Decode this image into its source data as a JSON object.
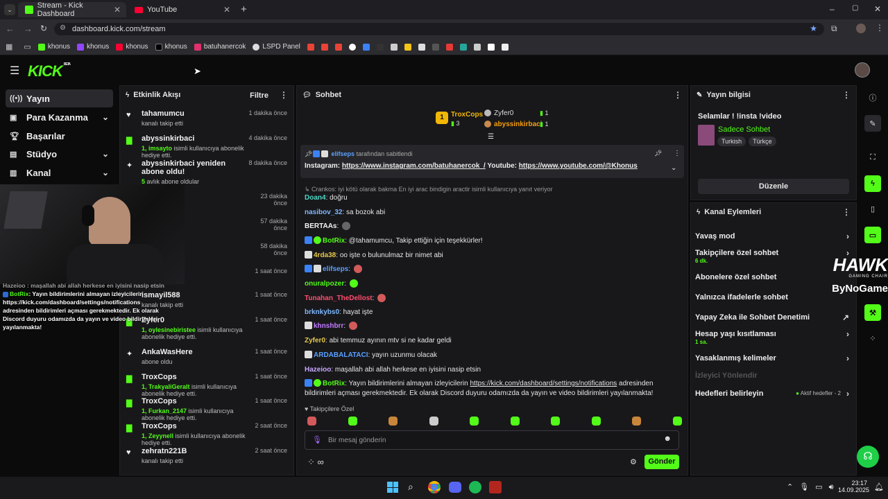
{
  "browser": {
    "tabs": [
      {
        "label": "Stream - Kick Dashboard",
        "active": true
      },
      {
        "label": "YouTube",
        "active": false
      }
    ],
    "url": "dashboard.kick.com/stream",
    "bookmarks": [
      "khonus",
      "khonus",
      "khonus",
      "khonus",
      "batuhanercok",
      "LSPD Panel"
    ]
  },
  "app": {
    "logo": "KICK",
    "logo_beta": "BETA"
  },
  "sidebar": {
    "items": [
      {
        "label": "Yayın",
        "icon": "broadcast-icon",
        "active": true,
        "chevron": false
      },
      {
        "label": "Para Kazanma",
        "icon": "money-icon",
        "active": false,
        "chevron": true
      },
      {
        "label": "Başarılar",
        "icon": "trophy-icon",
        "active": false,
        "chevron": false
      },
      {
        "label": "Stüdyo",
        "icon": "studio-icon",
        "active": false,
        "chevron": true
      },
      {
        "label": "Kanal",
        "icon": "channel-icon",
        "active": false,
        "chevron": true
      }
    ]
  },
  "overlay_chat": {
    "line1": "Hazeioo : maşallah abi allah herkese en iyisini nasip etsin",
    "line2_user": "BotRix",
    "line2_text": ": Yayın bildirimlerini almayan izleyicilerin https://kick.com/dashboard/settings/notifications adresinden bildirimleri açması gerekmektedir. Ek olarak Discord duyuru odamızda da yayın ve video bildirimleri yayılanmakta!"
  },
  "activity": {
    "title": "Etkinlik Akışı",
    "filter": "Filtre",
    "items": [
      {
        "name": "tahamumcu",
        "sub": "kanalı takip etti",
        "time": "1 dakika önce",
        "icon": "heart-icon"
      },
      {
        "name": "abyssinkirbaci",
        "sub_hl": "1, imsayto",
        "sub": " isimli kullanıcıya abonelik hediye etti.",
        "time": "4 dakika önce",
        "icon": "gift-icon"
      },
      {
        "name": "abyssinkirbaci yeniden abone oldu!",
        "sub_hl": "5",
        "sub": " avlık abone oldular",
        "time": "8 dakika önce",
        "icon": "star-icon"
      },
      {
        "name": "",
        "sub": "",
        "time": "23 dakika önce",
        "icon": ""
      },
      {
        "name": "",
        "sub": "",
        "time": "57 dakika önce",
        "icon": ""
      },
      {
        "name": "",
        "sub": "",
        "time": "58 dakika önce",
        "icon": ""
      },
      {
        "name": "",
        "sub": "",
        "time": "1 saat önce",
        "icon": ""
      },
      {
        "name": "ismayil588",
        "sub": "kanalı takip etti",
        "time": "1 saat önce",
        "icon": ""
      },
      {
        "name": "Zyfer0",
        "sub_hl": "1, oylesinebiristee",
        "sub": " isimli kullanıcıya abonelik hediye etti.",
        "time": "1 saat önce",
        "icon": "gift-icon"
      },
      {
        "name": "AnkaWasHere",
        "sub": "abone oldu",
        "time": "1 saat önce",
        "icon": "star-icon"
      },
      {
        "name": "TroxCops",
        "sub_hl": "1, TrakyaliGeralt",
        "sub": " isimli kullanıcıya abonelik hediye etti.",
        "time": "1 saat önce",
        "icon": "gift-icon"
      },
      {
        "name": "TroxCops",
        "sub_hl": "1, Furkan_2147",
        "sub": " isimli kullanıcıya abonelik hediye etti.",
        "time": "1 saat önce",
        "icon": "gift-icon"
      },
      {
        "name": "TroxCops",
        "sub_hl": "1, Zeyynell",
        "sub": " isimli kullanıcıya abonelik hediye etti.",
        "time": "2 saat önce",
        "icon": "gift-icon"
      },
      {
        "name": "zehratn221B",
        "sub": "kanalı takip etti",
        "time": "2 saat önce",
        "icon": "heart-icon"
      }
    ]
  },
  "chat": {
    "title": "Sohbet",
    "leaderboard": [
      {
        "name": "TroxCops",
        "count": "3"
      },
      {
        "name": "Zyfer0",
        "count": "1"
      },
      {
        "name": "abyssinkirbaci",
        "count": "1"
      }
    ],
    "pinned_by_user": "elifseps",
    "pinned_by_text": "tarafından sabitlendi",
    "pinned_label1": "Instagram:",
    "pinned_link1": "https://www.instagram.com/batuhanercok_/",
    "pinned_label2": "Youtube:",
    "pinned_link2": "https://www.youtube.com/@Khonus",
    "reply_preview": "Crankos: iyi kötü olarak bakma En iyi arac bindigin aractir isimli kullanıcıya yanıt veriyor",
    "messages": [
      {
        "user": "Doan4",
        "color": "#4fd6c4",
        "text": "doğru"
      },
      {
        "user": "nasibov_32",
        "color": "#7fb8ff",
        "text": "sa bozok abi"
      },
      {
        "user": "BERTAAs",
        "color": "#f2f2f2",
        "text": ""
      },
      {
        "user": "BotRix",
        "color": "#53fc18",
        "text": "@tahamumcu, Takip ettiğin için teşekkürler!"
      },
      {
        "user": "4rda38",
        "color": "#e6c84a",
        "text": "oo işte o bulunulmaz bir nimet abi"
      },
      {
        "user": "elifseps",
        "color": "#5aa0ff",
        "text": ""
      },
      {
        "user": "onuralpozer",
        "color": "#53fc18",
        "text": ""
      },
      {
        "user": "Tunahan_TheDellost",
        "color": "#ff4d6d",
        "text": ""
      },
      {
        "user": "brknkybs0",
        "color": "#7fb8ff",
        "text": "hayat işte"
      },
      {
        "user": "khnshbrr",
        "color": "#c27bff",
        "text": ""
      },
      {
        "user": "Zyfer0",
        "color": "#e6c84a",
        "text": "abi temmuz ayının mtv si ne kadar geldi"
      },
      {
        "user": "ARDABALATACI",
        "color": "#5aa0ff",
        "text": "yayın uzunmu olacak"
      },
      {
        "user": "Hazeioo",
        "color": "#c9a7ff",
        "text": "maşallah abi allah herkese en iyisini nasip etsin"
      },
      {
        "user": "BotRix",
        "color": "#53fc18",
        "text": "Yayın bildirimlerini almayan izleyicilerin ",
        "link": "https://kick.com/dashboard/settings/notifications",
        "text2": " adresinden bildirimleri açması gerekmektedir. Ek olarak Discord duyuru odamızda da yayın ve video bildirimleri yayılanmakta!"
      }
    ],
    "followers_only": "Takipçilere Özel",
    "input_placeholder": "Bir mesaj gönderin",
    "send_label": "Gönder"
  },
  "stream_info": {
    "title": "Yayın bilgisi",
    "stream_title": "Selamlar ! !insta !video",
    "category": "Sadece Sohbet",
    "tags": [
      "Turkish",
      "Türkçe"
    ],
    "edit_label": "Düzenle"
  },
  "channel_actions": {
    "title": "Kanal Eylemleri",
    "items": [
      {
        "label": "Yavaş mod",
        "sub": "",
        "right": ""
      },
      {
        "label": "Takipçilere özel sohbet",
        "sub": "6 dk.",
        "right": ""
      },
      {
        "label": "Abonelere özel sohbet",
        "sub": "",
        "right": ""
      },
      {
        "label": "Yalnızca ifadelerle sohbet",
        "sub": "",
        "right": ""
      },
      {
        "label": "Yapay Zeka ile Sohbet Denetimi",
        "sub": "",
        "right": ""
      },
      {
        "label": "Hesap yaşı kısıtlaması",
        "sub": "1 sa.",
        "right": ""
      },
      {
        "label": "Yasaklanmış kelimeler",
        "sub": "",
        "right": ""
      },
      {
        "label": "İzleyici Yönlendir",
        "sub": "",
        "right": ""
      },
      {
        "label": "Hedefleri belirleyin",
        "sub": "",
        "right": "Aktif hedefler - 2"
      }
    ]
  },
  "watermark": {
    "line1": "HAWK",
    "line2": "GAMING CHAIR",
    "line3": "ByNoGame"
  },
  "taskbar": {
    "time": "23:17",
    "date": "14.09.2025"
  },
  "colors": {
    "accent": "#53fc18",
    "bg": "#0b0b0c",
    "panel": "#18181b"
  }
}
